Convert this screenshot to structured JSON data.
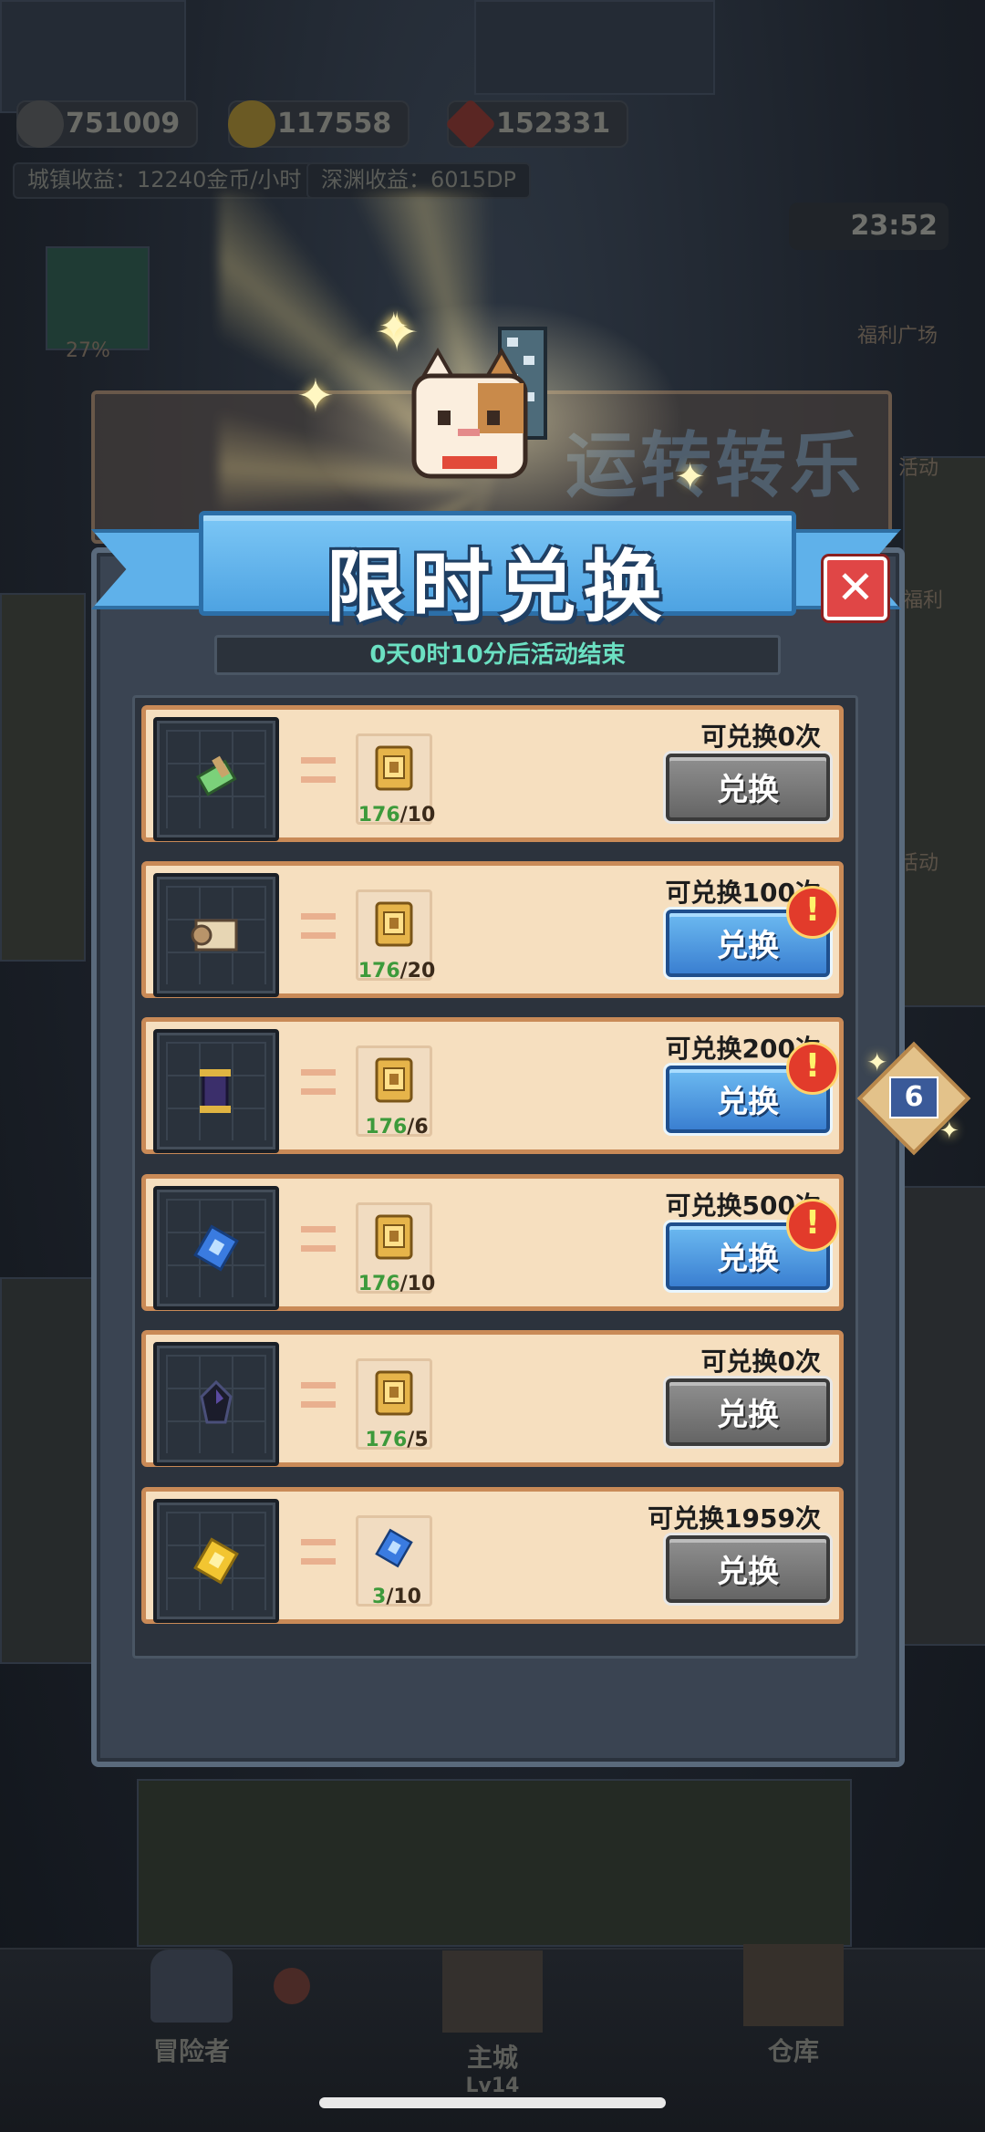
{
  "hud": {
    "stat1": "751009",
    "gold": "117558",
    "gems": "152331",
    "town_income": "城镇收益：12240金币/小时",
    "abyss_income": "深渊收益：6015DP",
    "time": "23:52",
    "side_labels": [
      "福利广场",
      "活动",
      "福利",
      "活动"
    ],
    "percent": "27%"
  },
  "bg_event_title": "运转转乐",
  "dialog": {
    "title": "限时兑换",
    "close_icon": "close-icon",
    "timer": "0天0时10分后活动结束"
  },
  "rows": [
    {
      "item_icon": "green-scroll-icon",
      "cost_icon": "gold-ticket-icon",
      "have": "176",
      "need": "/10",
      "quota": "可兑换0次",
      "button": "兑换",
      "state": "disabled",
      "alert": false
    },
    {
      "item_icon": "parchment-scroll-icon",
      "cost_icon": "gold-ticket-icon",
      "have": "176",
      "need": "/20",
      "quota": "可兑换100次",
      "button": "兑换",
      "state": "active",
      "alert": true
    },
    {
      "item_icon": "purple-scroll-icon",
      "cost_icon": "gold-ticket-icon",
      "have": "176",
      "need": "/6",
      "quota": "可兑换200次",
      "button": "兑换",
      "state": "active",
      "alert": true
    },
    {
      "item_icon": "blue-ticket-icon",
      "cost_icon": "gold-ticket-icon",
      "have": "176",
      "need": "/10",
      "quota": "可兑换500次",
      "button": "兑换",
      "state": "active",
      "alert": true
    },
    {
      "item_icon": "dark-crystal-icon",
      "cost_icon": "gold-ticket-icon",
      "have": "176",
      "need": "/5",
      "quota": "可兑换0次",
      "button": "兑换",
      "state": "disabled",
      "alert": false
    },
    {
      "item_icon": "yellow-ticket-icon",
      "cost_icon": "blue-ticket-icon",
      "have": "3",
      "need": "/10",
      "quota": "可兑换1959次",
      "button": "兑换",
      "state": "disabled",
      "alert": false
    }
  ],
  "alert_mark": "!",
  "float_badge": "6",
  "nav": {
    "adventurer": "冒险者",
    "main_city": "主城",
    "main_city_level": "Lv14",
    "warehouse": "仓库"
  },
  "colors": {
    "accent_blue": "#4ea3e2",
    "row_bg": "#f6dfbf",
    "have_green": "#3d9a3b",
    "timer_text": "#6be0c2",
    "close_red": "#e04646"
  }
}
